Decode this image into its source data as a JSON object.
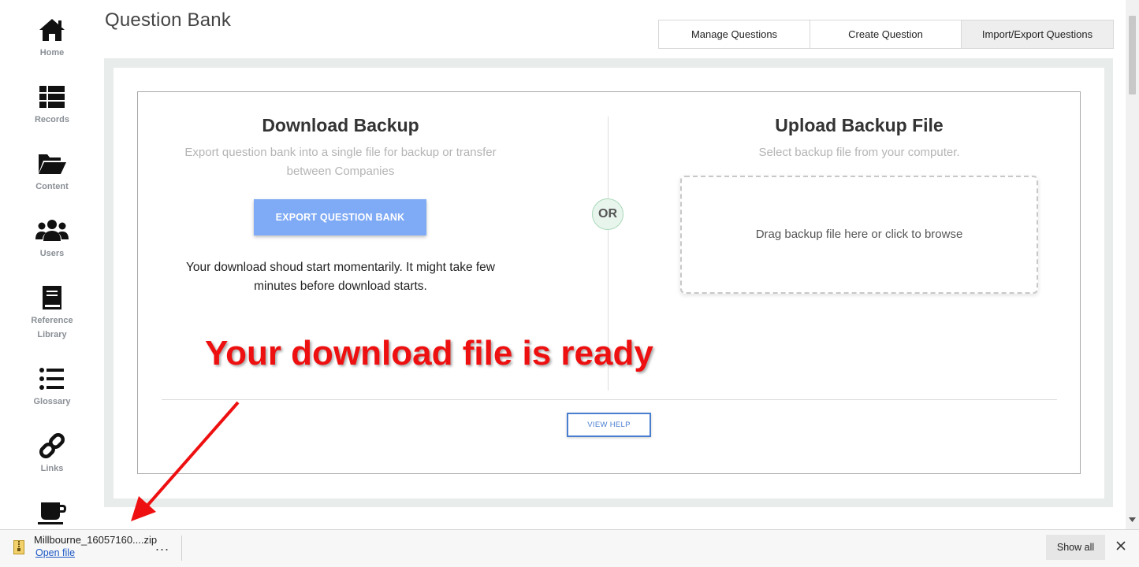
{
  "sidebar": {
    "items": [
      {
        "label": "Home",
        "icon": "home-icon"
      },
      {
        "label": "Records",
        "icon": "list-grid-icon"
      },
      {
        "label": "Content",
        "icon": "folder-open-icon"
      },
      {
        "label": "Users",
        "icon": "users-icon"
      },
      {
        "label": "Reference Library",
        "icon": "book-icon"
      },
      {
        "label": "Glossary",
        "icon": "list-icon"
      },
      {
        "label": "Links",
        "icon": "link-icon"
      },
      {
        "label": "",
        "icon": "coffee-cup-icon"
      }
    ]
  },
  "header": {
    "title": "Question Bank",
    "tabs": [
      {
        "label": "Manage Questions"
      },
      {
        "label": "Create Question"
      },
      {
        "label": "Import/Export Questions"
      }
    ]
  },
  "download_section": {
    "title": "Download Backup",
    "subtitle_line1": "Export question bank into a single file for backup or transfer",
    "subtitle_line2": "between Companies",
    "export_button": "EXPORT QUESTION BANK",
    "message_line1": "Your download shoud start momentarily. It might take few",
    "message_line2": "minutes before download starts."
  },
  "or_label": "OR",
  "upload_section": {
    "title": "Upload Backup File",
    "subtitle": "Select backup file from your computer.",
    "dropzone_text": "Drag backup file here or click to browse"
  },
  "help_button": "VIEW HELP",
  "annotation": {
    "text": "Your download file is ready",
    "color": "#ee1010"
  },
  "download_bar": {
    "file_name": "Millbourne_16057160....zip",
    "open_link": "Open file",
    "more_label": "...",
    "show_all": "Show all"
  },
  "colors": {
    "accent_button": "#7faaf5",
    "help_border": "#4a7fd0",
    "link": "#1a57c4"
  }
}
